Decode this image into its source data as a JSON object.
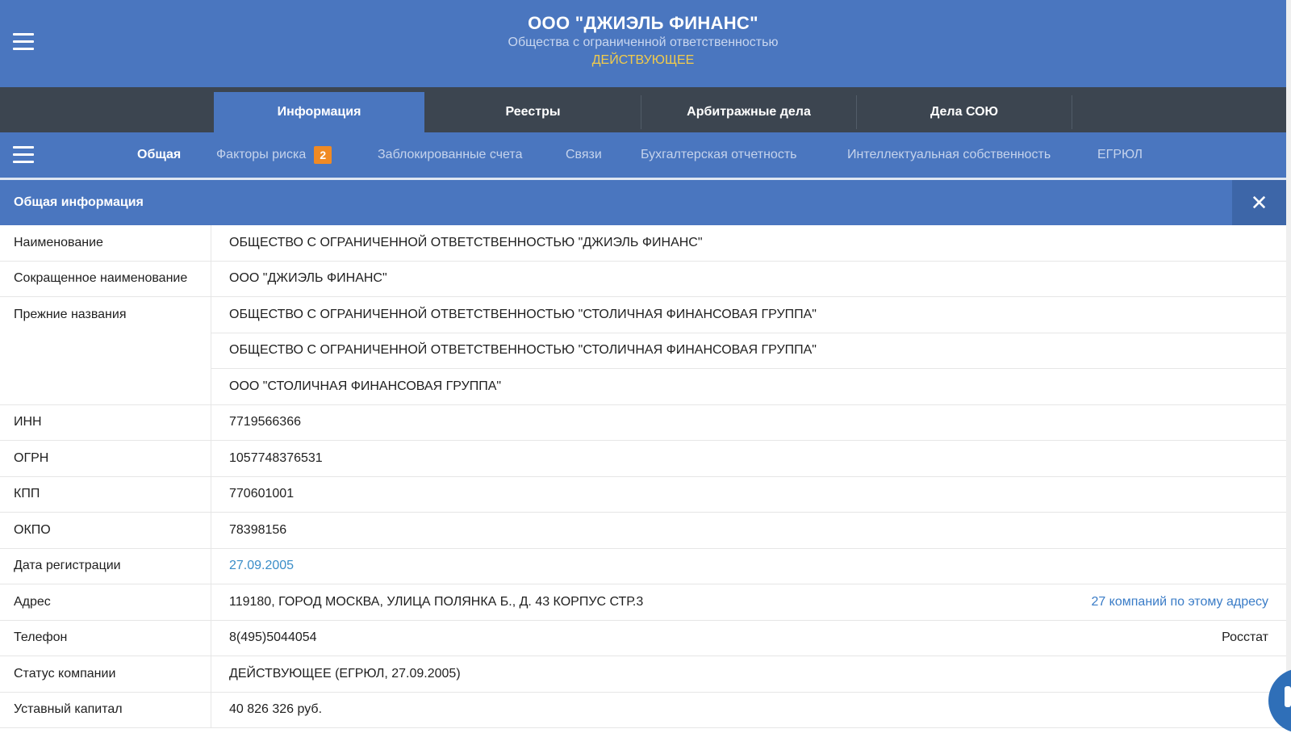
{
  "header": {
    "company_name": "ООО \"ДЖИЭЛЬ ФИНАНС\"",
    "legal_form": "Общества с ограниченной ответственностью",
    "status": "ДЕЙСТВУЮЩЕЕ",
    "status_color": "#f2cb4a",
    "background_color": "#4a76bf"
  },
  "icons": {
    "main_menu": "hamburger-menu-icon",
    "sub_menu": "hamburger-menu-icon",
    "close": "close-icon"
  },
  "tabs": [
    {
      "label": "Информация",
      "active": true
    },
    {
      "label": "Реестры",
      "active": false
    },
    {
      "label": "Арбитражные дела",
      "active": false
    },
    {
      "label": "Дела СОЮ",
      "active": false
    }
  ],
  "subnav": [
    {
      "label": "Общая",
      "active": true
    },
    {
      "label": "Факторы риска",
      "badge": "2"
    },
    {
      "label": "Заблокированные счета"
    },
    {
      "label": "Связи"
    },
    {
      "label": "Бухгалтерская отчетность"
    },
    {
      "label": "Интеллектуальная собственность"
    },
    {
      "label": "ЕГРЮЛ"
    }
  ],
  "section": {
    "title": "Общая информация",
    "close_label": "✕"
  },
  "rows": {
    "name": {
      "label": "Наименование",
      "value": "ОБЩЕСТВО С ОГРАНИЧЕННОЙ ОТВЕТСТВЕННОСТЬЮ \"ДЖИЭЛЬ ФИНАНС\""
    },
    "short_name": {
      "label": "Сокращенное наименование",
      "value": "ООО \"ДЖИЭЛЬ ФИНАНС\""
    },
    "former_names": {
      "label": "Прежние названия",
      "values": [
        "ОБЩЕСТВО С ОГРАНИЧЕННОЙ ОТВЕТСТВЕННОСТЬЮ \"СТОЛИЧНАЯ ФИНАНСОВАЯ ГРУППА\"",
        "ОБЩЕСТВО С ОГРАНИЧЕННОЙ ОТВЕТСТВЕННОСТЬЮ \"СТОЛИЧНАЯ ФИНАНСОВАЯ ГРУППА\"",
        "ООО \"СТОЛИЧНАЯ ФИНАНСОВАЯ ГРУППА\""
      ]
    },
    "inn": {
      "label": "ИНН",
      "value": "7719566366"
    },
    "ogrn": {
      "label": "ОГРН",
      "value": "1057748376531"
    },
    "kpp": {
      "label": "КПП",
      "value": "770601001"
    },
    "okpo": {
      "label": "ОКПО",
      "value": "78398156"
    },
    "reg_date": {
      "label": "Дата регистрации",
      "value": "27.09.2005"
    },
    "address": {
      "label": "Адрес",
      "value": "119180, ГОРОД МОСКВА, УЛИЦА ПОЛЯНКА Б., Д. 43 КОРПУС СТР.3",
      "extra_link": "27 компаний по этому адресу"
    },
    "phone": {
      "label": "Телефон",
      "value": "8(495)5044054",
      "source": "Росстат"
    },
    "company_status": {
      "label": "Статус компании",
      "value": "ДЕЙСТВУЮЩЕЕ (ЕГРЮЛ, 27.09.2005)"
    },
    "capital": {
      "label": "Уставный капитал",
      "value": "40 826 326 руб."
    }
  }
}
